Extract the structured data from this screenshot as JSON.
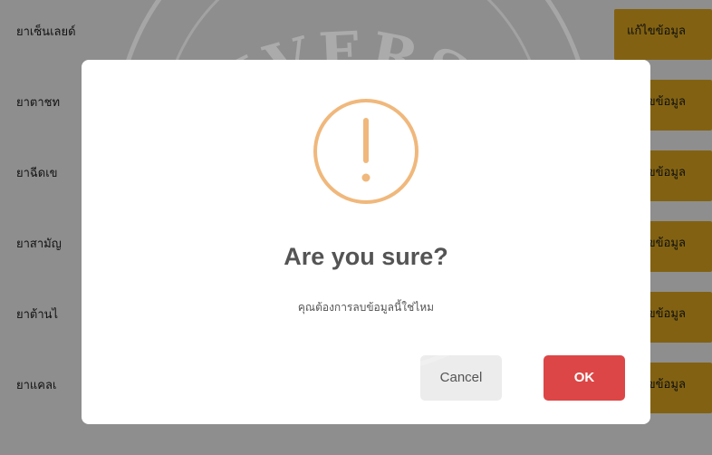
{
  "table": {
    "rows": [
      {
        "name": "ยาเซ็นเลยด์",
        "action": "แก้ไขข้อมูล"
      },
      {
        "name": "ยาตาชท",
        "action": "แก้ไขข้อมูล"
      },
      {
        "name": "ยาฉีดเข",
        "action": "แก้ไขข้อมูล"
      },
      {
        "name": "ยาสามัญ",
        "action": "แก้ไขข้อมูล"
      },
      {
        "name": "ยาต้านไ",
        "action": "แก้ไขข้อมูล"
      },
      {
        "name": "ยาแคลเ",
        "action": "แก้ไขข้อมูล"
      }
    ]
  },
  "watermark": {
    "text": "UNIVERSITY"
  },
  "dialog": {
    "icon": "warning-icon",
    "title": "Are you sure?",
    "text": "คุณต้องการลบข้อมูลนี้ใช่ไหม",
    "cancel_label": "Cancel",
    "ok_label": "OK"
  },
  "colors": {
    "action_button": "#e0aa20",
    "warning": "#f0b87c",
    "confirm": "#dd4646",
    "cancel": "#ececec"
  }
}
